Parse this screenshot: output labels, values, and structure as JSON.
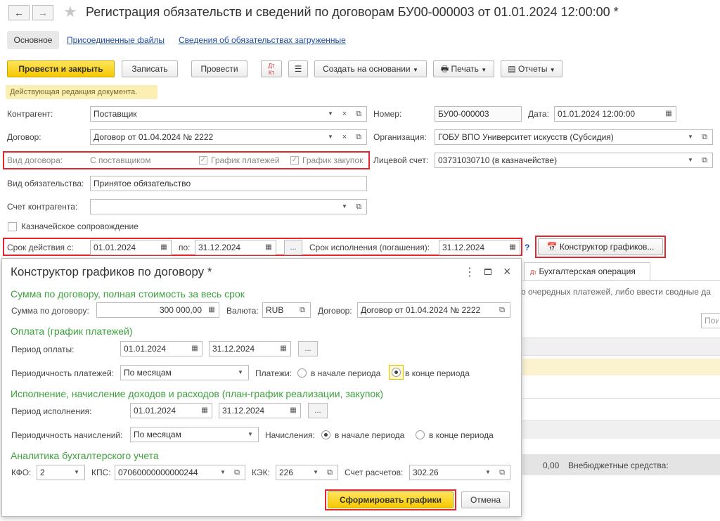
{
  "header": {
    "title": "Регистрация обязательств и сведений по договорам БУ00-000003 от 01.01.2024 12:00:00 *",
    "back_icon": "arrow-left-icon",
    "forward_icon": "arrow-right-icon",
    "favorite_icon": "star-icon"
  },
  "tabs": {
    "main": "Основное",
    "files": "Присоединенные файлы",
    "loaded": "Сведения об обязательствах загруженные"
  },
  "toolbar": {
    "post_close": "Провести и закрыть",
    "save": "Записать",
    "post": "Провести",
    "dtkt": "Дт Кт",
    "create_based": "Создать на основании",
    "print": "Печать",
    "reports": "Отчеты"
  },
  "notice": "Действующая редакция документа.",
  "form": {
    "counterparty_label": "Контрагент:",
    "counterparty": "Поставщик",
    "contract_label": "Договор:",
    "contract": "Договор от 01.04.2024 № 2222",
    "contract_type_label": "Вид договора:",
    "contract_type": "С поставщиком",
    "payment_schedule": "График платежей",
    "purchase_schedule": "График закупок",
    "obligation_type_label": "Вид обязательства:",
    "obligation_type": "Принятое обязательство",
    "cp_account_label": "Счет контрагента:",
    "cp_account": "",
    "treasury": "Казначейское сопровождение",
    "validity_label": "Срок действия с:",
    "validity_from": "01.01.2024",
    "to_label": "по:",
    "validity_to": "31.12.2024",
    "ellipsis": "...",
    "deadline_label": "Срок исполнения (погашения):",
    "deadline": "31.12.2024",
    "help": "?",
    "constructor_button": "Конструктор графиков...",
    "number_label": "Номер:",
    "number": "БУ00-000003",
    "date_label": "Дата:",
    "date": "01.01.2024 12:00:00",
    "org_label": "Организация:",
    "org": "ГОБУ ВПО Университет искусств (Субсидия)",
    "account_label": "Лицевой счет:",
    "account": "03731030710 (в казначействе)"
  },
  "background": {
    "tab_operation": "Бухгалтерская операция",
    "text_fragment": "о очередных платежей, либо ввести сводные да",
    "search_fragment": "Пои",
    "amount": "0,00",
    "extrabudget": "Внебюджетные средства:"
  },
  "dialog": {
    "title": "Конструктор графиков по договору *",
    "s1_title": "Сумма по договору, полная стоимость за весь срок",
    "sum_label": "Сумма по договору:",
    "sum": "300 000,00",
    "currency_label": "Валюта:",
    "currency": "RUB",
    "contract_label": "Договор:",
    "contract": "Договор от 01.04.2024 № 2222",
    "s2_title": "Оплата (график платежей)",
    "pay_period_label": "Период оплаты:",
    "pay_from": "01.01.2024",
    "pay_to": "31.12.2024",
    "pay_freq_label": "Периодичность платежей:",
    "pay_freq": "По месяцам",
    "payments_label": "Платежи:",
    "start_period": "в начале периода",
    "end_period": "в конце периода",
    "s3_title": "Исполнение, начисление доходов и расходов (план-график реализации, закупок)",
    "exec_period_label": "Период исполнения:",
    "exec_from": "01.01.2024",
    "exec_to": "31.12.2024",
    "accr_freq_label": "Периодичность начислений:",
    "accr_freq": "По месяцам",
    "accruals_label": "Начисления:",
    "s4_title": "Аналитика бухгалтерского учета",
    "kfo_label": "КФО:",
    "kfo": "2",
    "kps_label": "КПС:",
    "kps": "07060000000000244",
    "kek_label": "КЭК:",
    "kek": "226",
    "settle_label": "Счет расчетов:",
    "settle": "302.26",
    "generate": "Сформировать графики",
    "cancel": "Отмена",
    "menu_icon": "more-vertical-icon",
    "maximize_icon": "maximize-icon",
    "close_icon": "close-icon"
  },
  "colors": {
    "highlight": "#e3262e",
    "primary_button": "#f5c800",
    "section_title": "#3ea13e",
    "notice_bg": "#fcefb4"
  }
}
